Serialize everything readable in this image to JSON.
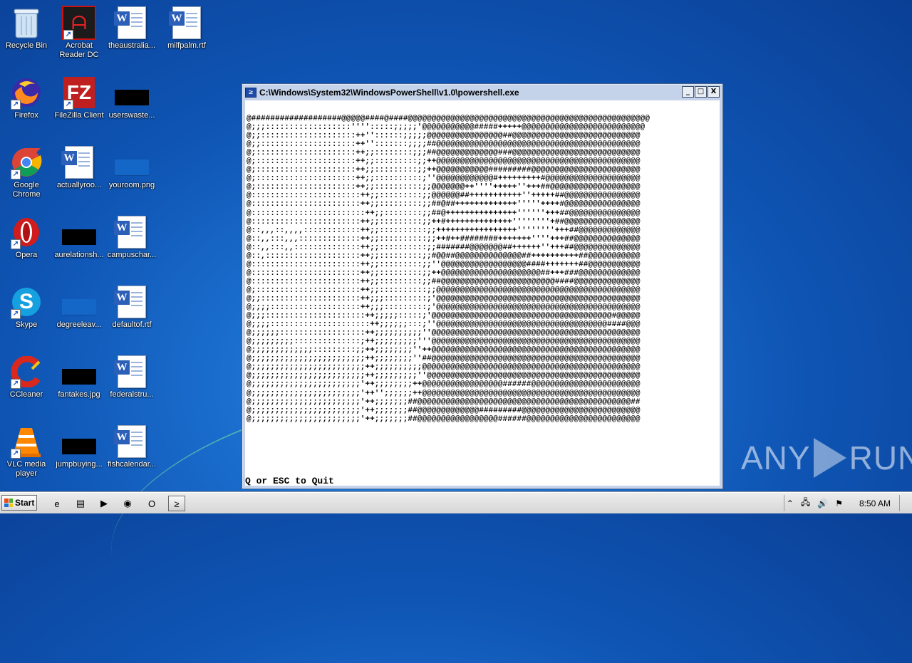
{
  "desktop": {
    "icons": [
      {
        "label": "Recycle Bin",
        "icon": "recycle-bin-icon"
      },
      {
        "label": "Acrobat Reader DC",
        "icon": "acrobat-icon"
      },
      {
        "label": "theaustralia...",
        "icon": "word-doc-icon"
      },
      {
        "label": "milfpalm.rtf",
        "icon": "word-doc-icon"
      },
      {
        "label": "Firefox",
        "icon": "firefox-icon"
      },
      {
        "label": "FileZilla Client",
        "icon": "filezilla-icon"
      },
      {
        "label": "userswaste...",
        "icon": "black-image-icon"
      },
      {
        "label": "Google Chrome",
        "icon": "chrome-icon"
      },
      {
        "label": "actuallyroo...",
        "icon": "word-doc-icon"
      },
      {
        "label": "youroom.png",
        "icon": "blue-image-icon"
      },
      {
        "label": "Opera",
        "icon": "opera-icon"
      },
      {
        "label": "aurelationsh...",
        "icon": "black-image-icon"
      },
      {
        "label": "campuschar...",
        "icon": "word-doc-icon"
      },
      {
        "label": "Skype",
        "icon": "skype-icon"
      },
      {
        "label": "degreeleav...",
        "icon": "blue-image-icon"
      },
      {
        "label": "defaultof.rtf",
        "icon": "word-doc-icon"
      },
      {
        "label": "CCleaner",
        "icon": "ccleaner-icon"
      },
      {
        "label": "fantakes.jpg",
        "icon": "black-image-icon"
      },
      {
        "label": "federalstru...",
        "icon": "word-doc-icon"
      },
      {
        "label": "VLC media player",
        "icon": "vlc-icon"
      },
      {
        "label": "jumpbuying...",
        "icon": "black-image-icon"
      },
      {
        "label": "fishcalendar...",
        "icon": "word-doc-icon"
      }
    ]
  },
  "window": {
    "title": "C:\\Windows\\System32\\WindowsPowerShell\\v1.0\\powershell.exe",
    "minimize": "_",
    "maximize": "□",
    "close": "X",
    "quit_text": "Q or ESC to Quit",
    "ascii_lines": [
      "@###################@@@@@####@####@@@@@@@@@@@@@@@@@@@@@@@@@@@@@@@@@@@@@@@@@@@@@@@@@@@",
      "@;;;::::::::::::::::::'''':::::;;;;;'@@@@@@@@@@@#####+++++@@@@@@@@@@@@@@@@@@@@@@@@@@",
      "@;;::::::::::::::::::::++''::::::;;;;;@@@@@@@@@@@@@@@@##@@@@@@@@@@@@@@@@@@@@@@@@@@@",
      "@;;::::::::::::::::::::++'':::::::;;;;##@@@@@@@@@@@@@@@@@@@@@@@@@@@@@@@@@@@@@@@@@@@",
      "@;:::::::::::::::::::::++;;::::::::;;;##@@@@@@@@@@@@@###@@@@@@@@@@@@@@@@@@@@@@@@@@@",
      "@;:::::::::::::::::::::++;;:::::::::;;++@@@@@@@@@@@@@@@@@@@@@@@@@@@@@@@@@@@@@@@@@@@",
      "@;:::::::::::::::::::::++;;:::::::::;;++@@@@@@@@@@@#########@@@@@@@@@@@@@@@@@@@@@@@",
      "@;:::::::::::::::::::::++;;::::::::::;''@@@@@@@@@@@@#+++++++++#@@@@@@@@@@@@@@@@@@@@",
      "@;:::::::::::::::::::::++;;::::::::::;;@@@@@@@++''''+++++''+++##@@@@@@@@@@@@@@@@@@@",
      "@:::::::::::::::::::::::++;;:::::::::;;@@@@@@##+++++++++++''+++++##@@@@@@@@@@@@@@@@",
      "@:::::::::::::::::::::::++;;:::::::::;;##@##+++++++++++++'''''++++#@@@@@@@@@@@@@@@@",
      "@::::::::::::::::::::::::++;;::::::::;;##@+++++++++++++++''''''+++##@@@@@@@@@@@@@@@",
      "@:::::::::::::::::::::::++;;:::::::::;;++#++++++++++++++''''''''+##@@@@@@@@@@@@@@@@",
      "@::,,,::,,,,::::::::::::++;;::::::::::;;+++++++++++++++++''''''''+++##@@@@@@@@@@@@@",
      "@::,,:::,,,:::::::::::::++;;::::::::::;;++#++########+++++++''''+++##@@@@@@@@@@@@@@",
      "@::,,:::,,::::::::::::::++;;::::::::::;;#######@@@@@@@##++++++''+++##@@@@@@@@@@@@@@",
      "@::,::::::::::::::::::::++;;:::::::::;;#@@##@@@@@@@@@@@@@@##++++++++++##@@@@@@@@@@@",
      "@:::::::::::::::::::::::++;;:::::::::;;''@@@@@@@@@@@@@@@@@@####+++++++##@@@@@@@@@@@",
      "@:::::::::::::::::::::::++;;:::::::::;;++@@@@@@@@@@@@@@@@@@@@@##+++###@@@@@@@@@@@@@",
      "@:::::::::::::::::::::::++;;:::::::::;;##@@@@@@@@@@@@@@@@@@@@@@@@####@@@@@@@@@@@@@@",
      "@;::::::::::::::::::::::++;;::::::::::;;@@@@@@@@@@@@@@@@@@@@@@@@@@@@@@@@@@@@@@@@@@@",
      "@;;:::::::::::::::::::::++;;;:::::::::;'@@@@@@@@@@@@@@@@@@@@@@@@@@@@@@@@@@@@@@@@@@@",
      "@;;;;:::::::::::::::::::++;;;:::::::::;'@@@@@@@@@@@@@@@@@@@@@@@@@@@@@@@@@@@@@@@@@@@",
      "@;;;:::::::::::::::::::::++;;;;;:::::;'@@@@@@@@@@@@@@@@@@@@@@@@@@@@@@@@@@@@@@#@@@@@",
      "@;;;;:::::::::::::::::::::++;;;;;;:::;''@@@@@@@@@@@@@@@@@@@@@@@@@@@@@@@@@@@@####@@@",
      "@;;;;;;::::::::::::::::::++;;;;;;;;;;''@@@@@@@@@@@@@@@@@@@@@@@@@@@@@@@@@@@@@@@@@@@@",
      "@;;;;;;;;;::::::::::::::;++;;;;;;;;;'''@@@@@@@@@@@@@@@@@@@@@@@@@@@@@@@@@@@@@@@@@@@@",
      "@;;;;;;;;;;;;;:::::::::;;++;;;;;;;;''++@@@@@@@@@@@@@@@@@@@@@@@@@@@@@@@@@@@@@@@@@@@@",
      "@;;;;;;;;;;;;;;;;;;;;;;;;++;;;;;;;;''##@@@@@@@@@@@@@@@@@@@@@@@@@@@@@@@@@@@@@@@@@@@@",
      "@;;;;;;;;;;;;;;;;;;;;;;;;++;;;;;;;;;;@@@@@@@@@@@@@@@@@@@@@@@@@@@@@@@@@@@@@@@@@@@@@@",
      "@;;;;;;;;;;;;;;;;;;;;;;;;++;;;;;;;;;''@@@@@@@@@@@@@@@@@@@@@@@@@@@@@@@@@@@@@@@@@@@@@",
      "@;;;;;;;;;;;;;;;;;;;;;;;'++;;;;;;;;++@@@@@@@@@@@@@@@@@######@@@@@@@@@@@@@@@@@@@@@@@",
      "@;;;;;;;;;;;;;;;;;;;;;;;'++'';;;;;;++@@@@@@@@@@@@@@@@@@@@@@@@@@@@@@@@@@@@@@@@@@@@@@",
      "@;;;;;;;;;;;;;;;;;;;;;;;'++;;;;;;;##@@@@@@@@@@@@@@@@@@@@@@@@@@@@@@@@@@@@@@@@@@@@@##",
      "@;;;;;;;;;;;;;;;;;;;;;;;'++;;;;;;;##@@@@@@@@@@@@@#########@@@@@@@@@@@@@@@@@@@@@@@@@",
      "@;;;;;;;;;;;;;;;;;;;;;;;'++;;;;;;;##@@@@@@@@@@@@@@@@@######@@@@@@@@@@@@@@@@@@@@@@@@"
    ]
  },
  "watermark": {
    "text_left": "ANY",
    "text_right": "RUN"
  },
  "taskbar": {
    "start_label": "Start",
    "items": [
      {
        "icon": "ie-icon",
        "glyph": "e"
      },
      {
        "icon": "explorer-icon",
        "glyph": "▤"
      },
      {
        "icon": "media-player-icon",
        "glyph": "▶"
      },
      {
        "icon": "chrome-icon",
        "glyph": "◉"
      },
      {
        "icon": "opera-icon",
        "glyph": "O"
      },
      {
        "icon": "powershell-icon",
        "glyph": "≥"
      }
    ],
    "tray": {
      "chevron": "⌃",
      "network": "🖧",
      "volume": "🔊",
      "flag": "⚑",
      "time": "8:50 AM"
    }
  },
  "colors": {
    "desktop_bg": "#1b6fcf",
    "console_bg": "#ffffff",
    "console_text": "#000000",
    "window_frame": "#c4d3ea",
    "taskbar_bg": "#dcdcdc"
  }
}
